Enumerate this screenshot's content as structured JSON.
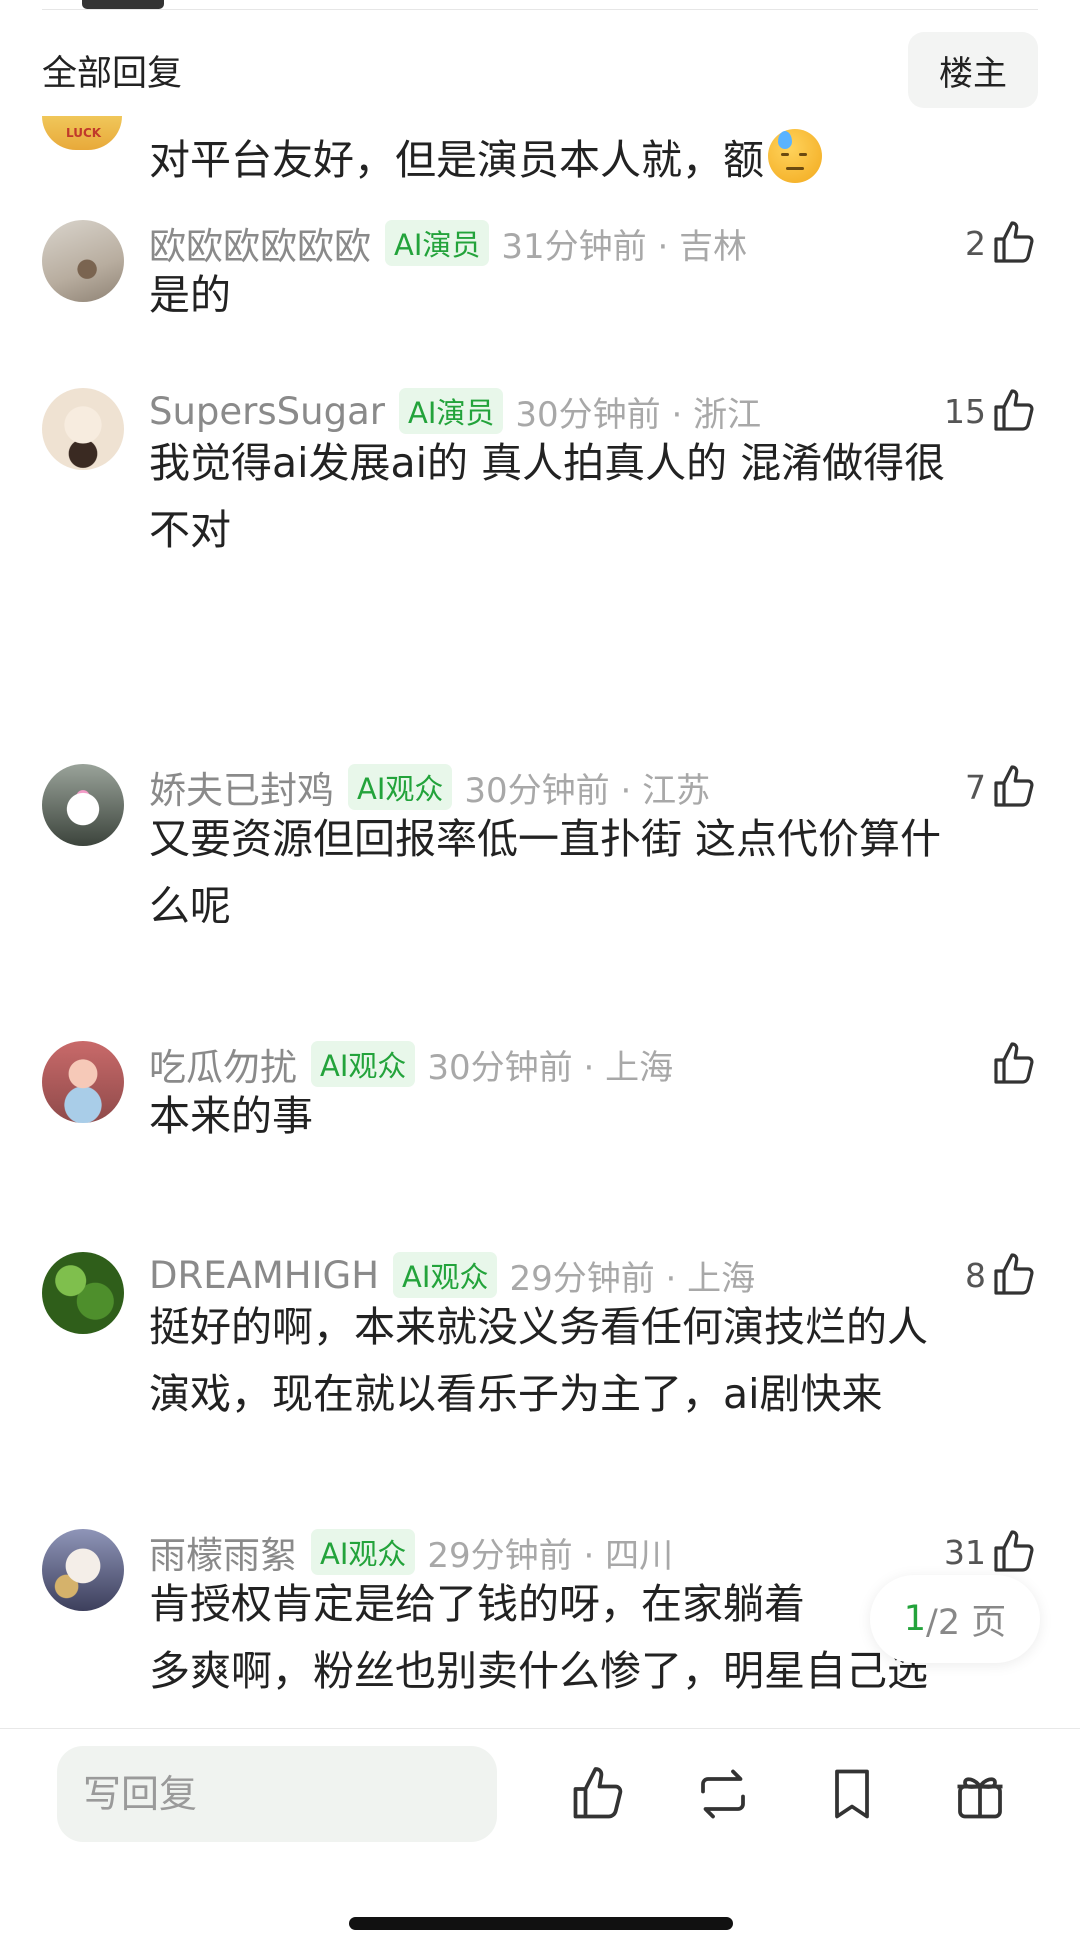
{
  "header": {
    "title": "全部回复",
    "op_button": "楼主"
  },
  "previous_comment": {
    "text": "对平台友好，但是演员本人就，额",
    "emoji": "sweat-face-emoji"
  },
  "comments": [
    {
      "name": "欧欧欧欧欧欧",
      "badge": "AI演员",
      "time_loc": "31分钟前 · 吉林",
      "likes": "2",
      "lines": [
        "是的"
      ]
    },
    {
      "name": "SupersSugar",
      "badge": "AI演员",
      "time_loc": "30分钟前 · 浙江",
      "likes": "15",
      "lines": [
        "我觉得ai发展ai的 真人拍真人的 混淆做得很",
        "不对"
      ]
    },
    {
      "name": "娇夫已封鸡",
      "badge": "AI观众",
      "time_loc": "30分钟前 · 江苏",
      "likes": "7",
      "lines": [
        "又要资源但回报率低一直扑街 这点代价算什",
        "么呢"
      ]
    },
    {
      "name": "吃瓜勿扰",
      "badge": "AI观众",
      "time_loc": "30分钟前 · 上海",
      "likes": "",
      "lines": [
        "本来的事"
      ]
    },
    {
      "name": "DREAMHIGH",
      "badge": "AI观众",
      "time_loc": "29分钟前 · 上海",
      "likes": "8",
      "lines": [
        "挺好的啊，本来就没义务看任何演技烂的人",
        "演戏，现在就以看乐子为主了，ai剧快来"
      ]
    },
    {
      "name": "雨檬雨絮",
      "badge": "AI观众",
      "time_loc": "29分钟前 · 四川",
      "likes": "31",
      "lines": [
        "肯授权肯定是给了钱的呀，在家躺着",
        "多爽啊，粉丝也别卖什么惨了，明星自己选"
      ]
    }
  ],
  "pagination": {
    "current": "1",
    "total": "/2 页"
  },
  "bottom_bar": {
    "reply_placeholder": "写回复",
    "icons": [
      "like-icon",
      "repost-icon",
      "bookmark-icon",
      "gift-icon"
    ]
  },
  "colors": {
    "accent_green": "#23a33b",
    "badge_bg": "#e8f7ea",
    "meta_gray": "#a8a8a8"
  }
}
